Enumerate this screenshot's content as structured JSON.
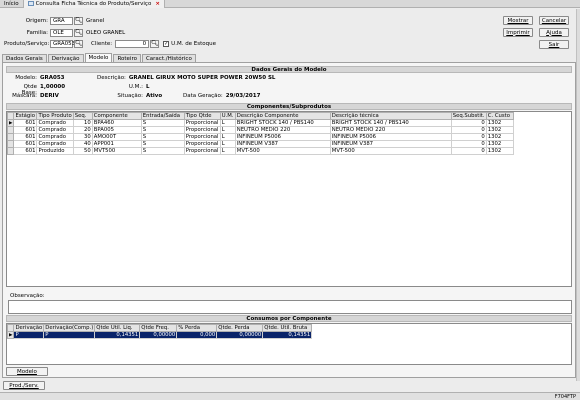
{
  "tabs": [
    {
      "label": "Início",
      "active": false
    },
    {
      "label": "Consulta Ficha Técnica do Produto/Serviço",
      "active": true
    }
  ],
  "filters": {
    "origem": {
      "label": "Origem:",
      "value": "GRA",
      "desc": "Granel"
    },
    "familia": {
      "label": "Familia:",
      "value": "OLE",
      "desc": "OLEO GRANEL"
    },
    "produto": {
      "label": "Produto/Serviço:",
      "value": "GRA053"
    },
    "cliente": {
      "label": "Cliente:",
      "value": "0"
    },
    "um_estoque": {
      "label": "U.M. de Estoque",
      "checked": true
    }
  },
  "buttons": {
    "mostrar": "Mostrar",
    "cancelar": "Cancelar",
    "imprimir": "Imprimir",
    "ajuda": "Ajuda",
    "sair": "Sair",
    "modelo": "Modelo",
    "prod_serv": "Prod./Serv."
  },
  "subtabs": [
    "Dados Gerais",
    "Derivação",
    "Modelo",
    "Roteiro",
    "Caract./Histórico"
  ],
  "active_subtab": "Modelo",
  "dados_gerais": {
    "title": "Dados Gerais do Modelo",
    "modelo_label": "Modelo:",
    "modelo": "GRA053",
    "descricao_label": "Descrição:",
    "descricao": "GRANEL GIRUX MOTO SUPER POWER 20W50 SL",
    "qtde_base_label": "Qtde Base:",
    "qtde_base": "1,00000",
    "um_label": "U.M.:",
    "um": "L",
    "mascara_label": "Máscara:",
    "mascara": "DERIV",
    "situacao_label": "Situação:",
    "situacao": "Ativo",
    "data_geracao_label": "Data Geração:",
    "data_geracao": "29/03/2017"
  },
  "componentes": {
    "title": "Componentes/Subprodutos",
    "columns": [
      "Estágio",
      "Tipo Produto",
      "Seq.",
      "Componente",
      "Entrada/Saída",
      "Tipo Qtde",
      "U.M.",
      "Descrição Componente",
      "Descrição técnica",
      "Seq.Substit.",
      "C. Custo"
    ],
    "rows": [
      [
        "601",
        "Comprado",
        "10",
        "BPA460",
        "S",
        "Proporcional",
        "L",
        "BRIGHT STOCK 140 / PBS140",
        "BRIGHT STOCK 140 / PBS140",
        "0",
        "1302"
      ],
      [
        "601",
        "Comprado",
        "20",
        "BPA005",
        "S",
        "Proporcional",
        "L",
        "NEUTRO MEDIO 220",
        "NEUTRO MEDIO 220",
        "0",
        "1302"
      ],
      [
        "601",
        "Comprado",
        "30",
        "AMO00T",
        "S",
        "Proporcional",
        "L",
        "INFINEUM P5006",
        "INFINEUM P5006",
        "0",
        "1302"
      ],
      [
        "601",
        "Comprado",
        "40",
        "APP001",
        "S",
        "Proporcional",
        "L",
        "INFINEUM V387",
        "INFINEUM V387",
        "0",
        "1302"
      ],
      [
        "601",
        "Produzido",
        "50",
        "MVT500",
        "S",
        "Proporcional",
        "L",
        "MVT-500",
        "MVT-500",
        "0",
        "1302"
      ]
    ]
  },
  "observacao_label": "Observação:",
  "consumos": {
    "title": "Consumos por Componente",
    "columns": [
      "Derivação",
      "Derivação(Comp.)",
      "Qtde Util. Liq.",
      "Qtde Freq.",
      "% Perda",
      "Qtde. Perda",
      "Qtde. Util. Bruta"
    ],
    "rows": [
      [
        "P",
        "P",
        "0,14351",
        "0,00000",
        "0,000",
        "0,00000",
        "0,14351"
      ]
    ]
  },
  "status_code": "F704FTP"
}
